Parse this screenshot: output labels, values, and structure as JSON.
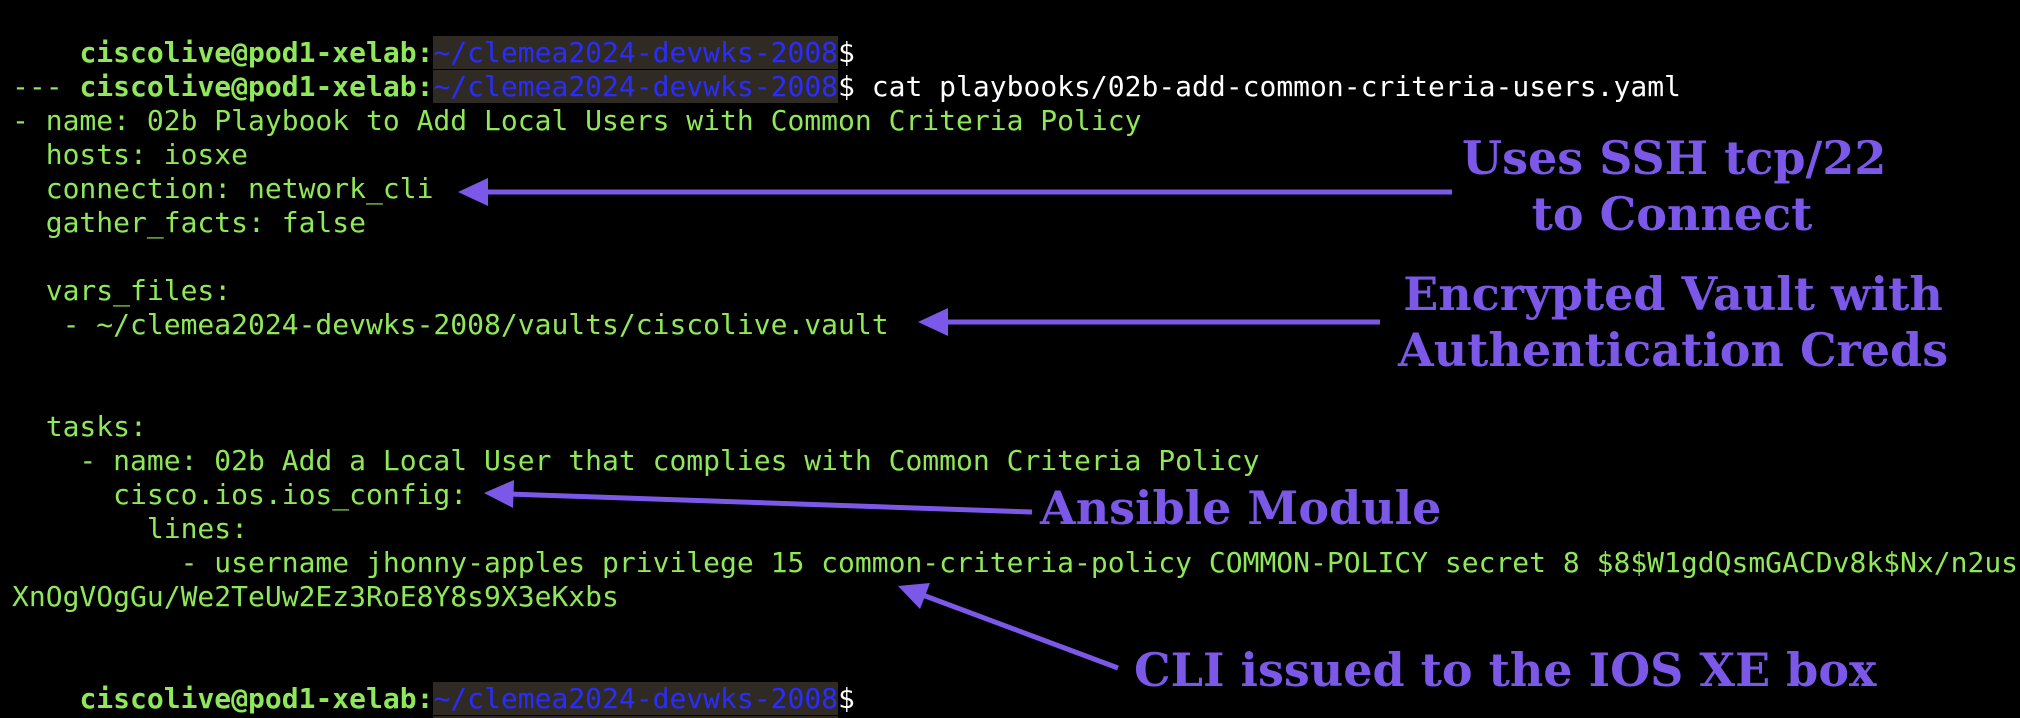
{
  "prompt": {
    "user": "ciscolive@pod1-xelab:",
    "path": "~/clemea2024-devwks-2008",
    "sign": "$"
  },
  "command": " cat playbooks/02b-add-common-criteria-users.yaml",
  "yaml_lines": [
    "---",
    "- name: 02b Playbook to Add Local Users with Common Criteria Policy",
    "  hosts: iosxe",
    "  connection: network_cli",
    "  gather_facts: false",
    "",
    "  vars_files:",
    "   - ~/clemea2024-devwks-2008/vaults/ciscolive.vault",
    "",
    "",
    "  tasks:",
    "    - name: 02b Add a Local User that complies with Common Criteria Policy",
    "      cisco.ios.ios_config:",
    "        lines:",
    "          - username jhonny-apples privilege 15 common-criteria-policy COMMON-POLICY secret 8 $8$W1gdQsmGACDv8k$Nx/n2us",
    "XnOgVOgGu/We2TeUw2Ez3RoE8Y8s9X3eKxbs",
    ""
  ],
  "annotations": {
    "ssh": "Uses SSH tcp/22\nto Connect",
    "vault": "Encrypted Vault with\nAuthentication Creds",
    "module": "Ansible Module",
    "cli": "CLI issued to the IOS XE box"
  },
  "colors": {
    "background": "#000000",
    "text_green": "#8fe85a",
    "path_blue": "#2a2cff",
    "annotation_purple": "#7b58e8"
  }
}
